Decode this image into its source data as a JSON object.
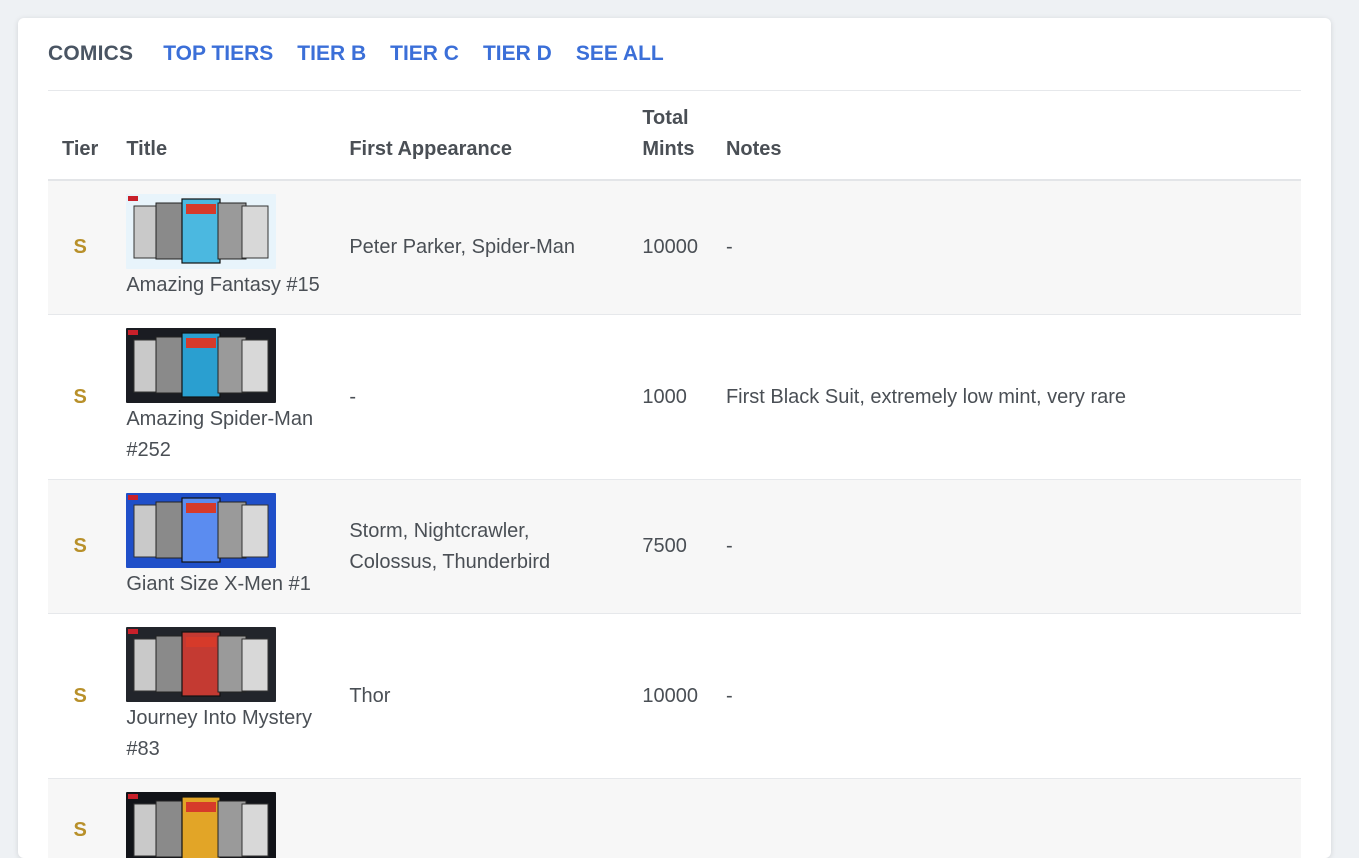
{
  "nav": {
    "brand": "COMICS",
    "links": [
      "TOP TIERS",
      "TIER B",
      "TIER C",
      "TIER D",
      "SEE ALL"
    ]
  },
  "table": {
    "headers": {
      "tier": "Tier",
      "title": "Title",
      "first_appearance": "First Appearance",
      "total_mints": "Total Mints",
      "notes": "Notes"
    },
    "rows": [
      {
        "tier": "S",
        "title": "Amazing Fantasy #15",
        "first_appearance": "Peter Parker, Spider-Man",
        "total_mints": "10000",
        "notes": "-",
        "thumb_bg": "#e8f4fb",
        "thumb_accent": "#4bb8e0"
      },
      {
        "tier": "S",
        "title": "Amazing Spider-Man #252",
        "first_appearance": "-",
        "total_mints": "1000",
        "notes": "First Black Suit, extremely low mint, very rare",
        "thumb_bg": "#1a1c22",
        "thumb_accent": "#2a9fd0"
      },
      {
        "tier": "S",
        "title": "Giant Size X-Men #1",
        "first_appearance": "Storm, Nightcrawler, Colossus, Thunderbird",
        "total_mints": "7500",
        "notes": "-",
        "thumb_bg": "#1f4fc9",
        "thumb_accent": "#5b8cf0"
      },
      {
        "tier": "S",
        "title": "Journey Into Mystery #83",
        "first_appearance": "Thor",
        "total_mints": "10000",
        "notes": "-",
        "thumb_bg": "#22252b",
        "thumb_accent": "#c43a32"
      },
      {
        "tier": "S",
        "title": "",
        "first_appearance": "",
        "total_mints": "",
        "notes": "",
        "thumb_bg": "#111318",
        "thumb_accent": "#e2a527"
      }
    ]
  },
  "colors": {
    "link": "#3b6fd8",
    "tier_s": "#b8902a",
    "row_alt": "#f7f7f7"
  }
}
